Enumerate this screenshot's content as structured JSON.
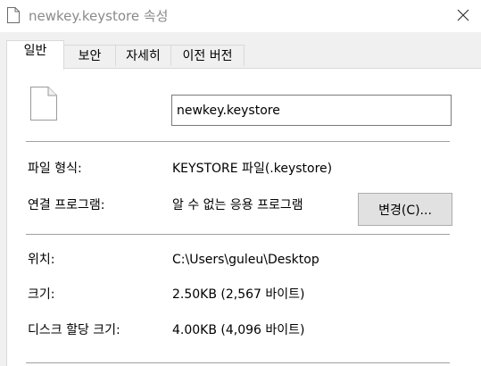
{
  "window": {
    "title": "newkey.keystore 속성",
    "title_icon": "file-icon",
    "close_icon": "close-icon"
  },
  "tabs": [
    {
      "label": "일반",
      "active": true
    },
    {
      "label": "보안",
      "active": false
    },
    {
      "label": "자세히",
      "active": false
    },
    {
      "label": "이전 버전",
      "active": false
    }
  ],
  "general": {
    "file_icon": "document-icon",
    "filename": "newkey.keystore",
    "file_type_label": "파일 형식:",
    "file_type_value": "KEYSTORE 파일(.keystore)",
    "opens_with_label": "연결 프로그램:",
    "opens_with_value": "알 수 없는 응용 프로그램",
    "change_button": "변경(C)...",
    "location_label": "위치:",
    "location_value": "C:\\Users\\guleu\\Desktop",
    "size_label": "크기:",
    "size_value": "2.50KB (2,567 바이트)",
    "size_on_disk_label": "디스크 할당 크기:",
    "size_on_disk_value": "4.00KB (4,096 바이트)"
  },
  "colors": {
    "tab_strip_bg": "#f0f0f0",
    "border": "#d9d9d9",
    "button_bg": "#e1e1e1",
    "title_text": "#8a8a8a"
  }
}
